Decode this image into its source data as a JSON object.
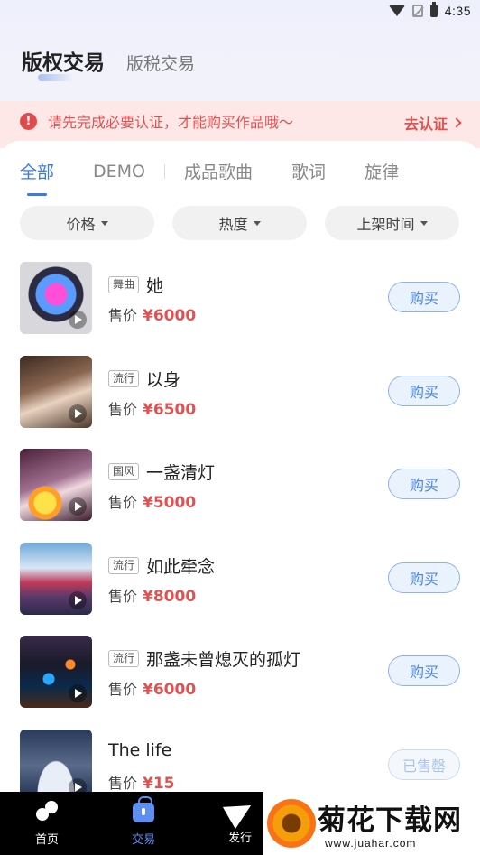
{
  "status_bar": {
    "time": "4:35"
  },
  "header": {
    "tabs": [
      {
        "label": "版权交易"
      },
      {
        "label": "版税交易"
      }
    ]
  },
  "notice": {
    "text": "请先完成必要认证，才能购买作品哦～",
    "link_label": "去认证"
  },
  "categories": [
    {
      "label": "全部"
    },
    {
      "label": "DEMO"
    },
    {
      "label": "成品歌曲"
    },
    {
      "label": "歌词"
    },
    {
      "label": "旋律"
    }
  ],
  "filters": [
    {
      "label": "价格"
    },
    {
      "label": "热度"
    },
    {
      "label": "上架时间"
    }
  ],
  "items": [
    {
      "tag": "舞曲",
      "title": "她",
      "price_label": "售价",
      "price": "¥6000",
      "action": "购买"
    },
    {
      "tag": "流行",
      "title": "以身",
      "price_label": "售价",
      "price": "¥6500",
      "action": "购买"
    },
    {
      "tag": "国风",
      "title": "一盏清灯",
      "price_label": "售价",
      "price": "¥5000",
      "action": "购买"
    },
    {
      "tag": "流行",
      "title": "如此牵念",
      "price_label": "售价",
      "price": "¥8000",
      "action": "购买"
    },
    {
      "tag": "流行",
      "title": "那盏未曾熄灭的孤灯",
      "price_label": "售价",
      "price": "¥6000",
      "action": "购买"
    },
    {
      "tag": "",
      "title": "The life",
      "price_label": "售价",
      "price": "¥15",
      "action": "已售罄"
    }
  ],
  "bottom_nav": [
    {
      "label": "首页"
    },
    {
      "label": "交易"
    },
    {
      "label": "发行"
    }
  ],
  "watermark": {
    "title": "菊花下载网",
    "url": "www.juahar.com"
  },
  "colors": {
    "accent": "#3e7be0",
    "price": "#e05252",
    "notice_bg": "#fde7e7"
  }
}
